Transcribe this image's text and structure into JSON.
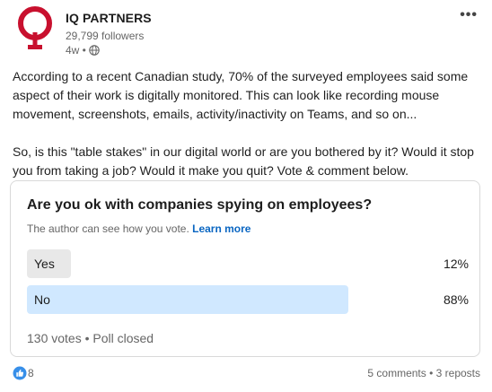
{
  "header": {
    "company_name": "IQ PARTNERS",
    "followers": "29,799 followers",
    "time_ago": "4w •",
    "visibility_icon": "globe-icon",
    "more_label": "•••",
    "logo_color": "#c8102e"
  },
  "post": {
    "paragraph_1": "According to a recent Canadian study, 70% of the surveyed employees said some aspect of their work is digitally monitored. This can look like recording mouse movement, screenshots, emails, activity/inactivity on Teams, and so on...",
    "paragraph_2": "So, is this \"table stakes\" in our digital world or are you bothered by it? Would it stop you from taking a job? Would it make you quit? Vote & comment below."
  },
  "poll": {
    "question": "Are you ok with companies spying on employees?",
    "note": "The author can see how you vote.",
    "learn_more": "Learn more",
    "options": [
      {
        "label": "Yes",
        "percent": "12%",
        "share": 0.12,
        "color": "#e8e8e8"
      },
      {
        "label": "No",
        "percent": "88%",
        "share": 0.88,
        "color": "#d0e8ff"
      }
    ],
    "footer": "130 votes • Poll closed"
  },
  "social": {
    "reaction_icon": "like-icon",
    "reaction_count": "8",
    "comments": "5 comments",
    "separator": " • ",
    "reposts": "3 reposts"
  }
}
